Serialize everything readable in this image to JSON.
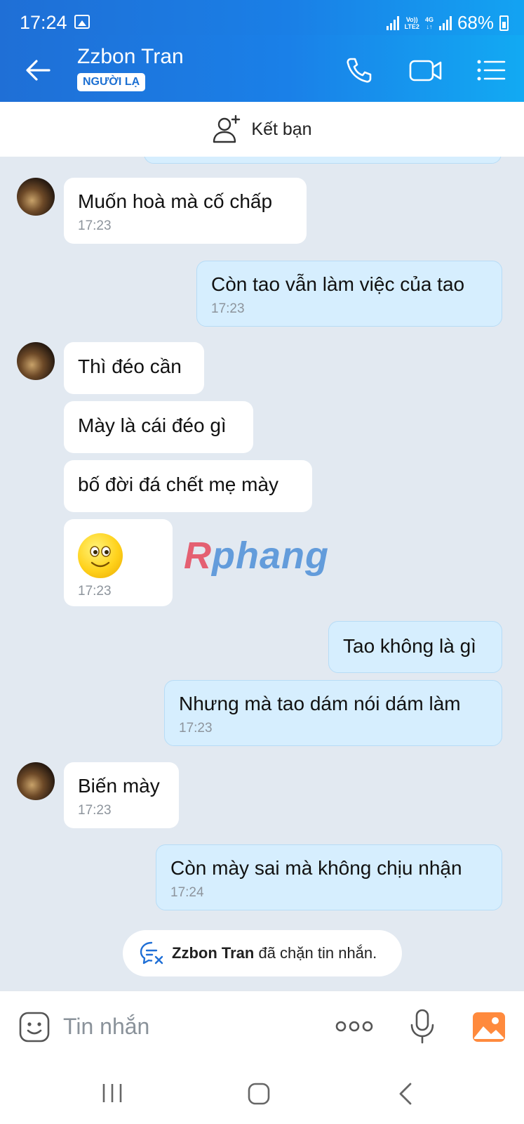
{
  "status_bar": {
    "time": "17:24",
    "network": "4G",
    "volte": "VoLTE2",
    "battery": "68%"
  },
  "header": {
    "contact_name": "Zzbon Tran",
    "badge": "NGƯỜI LẠ"
  },
  "friend_bar": {
    "label": "Kết bạn"
  },
  "messages": [
    {
      "side": "in",
      "text": "Muốn hoà mà cố chấp",
      "time": "17:23"
    },
    {
      "side": "out",
      "text": "Còn tao vẫn làm việc của tao",
      "time": "17:23"
    },
    {
      "side": "in",
      "text": "Thì đéo cần"
    },
    {
      "side": "in",
      "text": "Mày là cái đéo gì"
    },
    {
      "side": "in",
      "text": "bố đời đá chết mẹ mày"
    },
    {
      "side": "in",
      "emoji": "smiley",
      "time": "17:23"
    },
    {
      "side": "out",
      "text": "Tao không là gì"
    },
    {
      "side": "out",
      "text": "Nhưng mà tao dám nói dám làm",
      "time": "17:23"
    },
    {
      "side": "in",
      "text": "Biến mày",
      "time": "17:23"
    },
    {
      "side": "out",
      "text": "Còn mày sai mà không chịu nhận",
      "time": "17:24"
    }
  ],
  "watermark": {
    "first_letter": "R",
    "rest": "phang"
  },
  "blocked_notice": {
    "name": "Zzbon Tran",
    "text": "đã chặn tin nhắn."
  },
  "input": {
    "placeholder": "Tin nhắn"
  },
  "colors": {
    "header": "#1a80e8",
    "outgoing_bubble": "#d6eefe",
    "incoming_bubble": "#ffffff",
    "background": "#e2e9f1"
  }
}
